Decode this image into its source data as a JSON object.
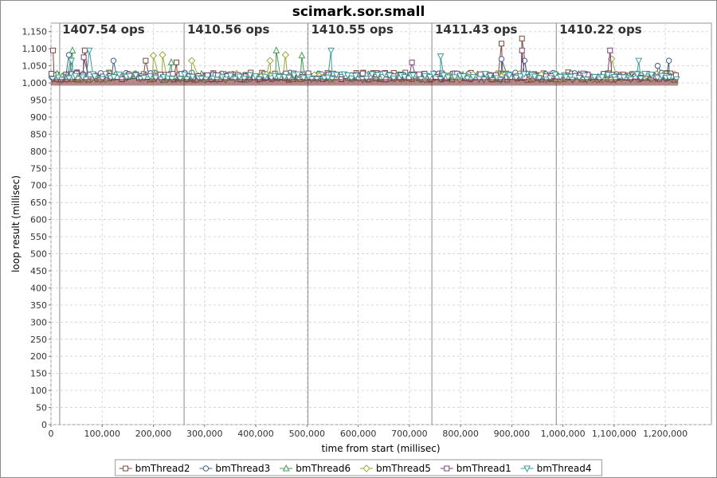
{
  "chart_data": {
    "type": "line",
    "title": "scimark.sor.small",
    "xlabel": "time from start (millisec)",
    "ylabel": "loop result (millisec)",
    "xlim": [
      0,
      1290000
    ],
    "ylim": [
      0,
      1175
    ],
    "x_ticks": [
      "0",
      "100,000",
      "200,000",
      "300,000",
      "400,000",
      "500,000",
      "600,000",
      "700,000",
      "800,000",
      "900,000",
      "1,000,000",
      "1,100,000",
      "1,200,000"
    ],
    "x_tick_values": [
      0,
      100000,
      200000,
      300000,
      400000,
      500000,
      600000,
      700000,
      800000,
      900000,
      1000000,
      1100000,
      1200000
    ],
    "y_ticks": [
      "0",
      "50",
      "100",
      "150",
      "200",
      "250",
      "300",
      "350",
      "400",
      "450",
      "500",
      "550",
      "600",
      "650",
      "700",
      "750",
      "800",
      "850",
      "900",
      "950",
      "1,000",
      "1,050",
      "1,100",
      "1,150"
    ],
    "y_tick_values": [
      0,
      50,
      100,
      150,
      200,
      250,
      300,
      350,
      400,
      450,
      500,
      550,
      600,
      650,
      700,
      750,
      800,
      850,
      900,
      950,
      1000,
      1050,
      1100,
      1150
    ],
    "grid": true,
    "legend_position": "bottom",
    "x_start": 0,
    "x_end": 1225000,
    "phase_markers": [
      17000,
      260000,
      502000,
      744000,
      987000
    ],
    "annotations": [
      {
        "text": "1407.54 ops",
        "x": 22000
      },
      {
        "text": "1410.56 ops",
        "x": 266000
      },
      {
        "text": "1410.55 ops",
        "x": 508000
      },
      {
        "text": "1411.43 ops",
        "x": 750000
      },
      {
        "text": "1410.22 ops",
        "x": 993000
      }
    ],
    "series": [
      {
        "name": "bmThread2",
        "marker": "square",
        "color": "#7a4a3a",
        "base": 1020,
        "spread": 22,
        "spikes": [
          [
            4000,
            1095
          ],
          [
            66000,
            1095
          ],
          [
            185000,
            1065
          ],
          [
            880000,
            1115
          ],
          [
            920000,
            1130
          ],
          [
            245000,
            1060
          ]
        ]
      },
      {
        "name": "bmThread3",
        "marker": "circle",
        "color": "#3e5f8a",
        "base": 1020,
        "spread": 20,
        "spikes": [
          [
            35000,
            1082
          ],
          [
            122000,
            1065
          ],
          [
            880000,
            1070
          ],
          [
            925000,
            1065
          ],
          [
            1207000,
            1065
          ],
          [
            1185000,
            1050
          ]
        ]
      },
      {
        "name": "bmThread6",
        "marker": "triangle-up",
        "color": "#3f9a52",
        "base": 1018,
        "spread": 18,
        "spikes": [
          [
            42000,
            1095
          ],
          [
            440000,
            1095
          ],
          [
            490000,
            1080
          ],
          [
            235000,
            1060
          ]
        ]
      },
      {
        "name": "bmThread5",
        "marker": "diamond",
        "color": "#9aa83a",
        "base": 1018,
        "spread": 18,
        "spikes": [
          [
            200000,
            1080
          ],
          [
            218000,
            1082
          ],
          [
            458000,
            1082
          ],
          [
            275000,
            1065
          ],
          [
            428000,
            1065
          ],
          [
            1095000,
            1070
          ]
        ]
      },
      {
        "name": "bmThread1",
        "marker": "square",
        "color": "#7b3f76",
        "base": 1019,
        "spread": 18,
        "spikes": [
          [
            920000,
            1095
          ],
          [
            1092000,
            1095
          ],
          [
            64000,
            1075
          ],
          [
            705000,
            1060
          ]
        ]
      },
      {
        "name": "bmThread4",
        "marker": "triangle-down",
        "color": "#3c9a9a",
        "base": 1018,
        "spread": 18,
        "spikes": [
          [
            75000,
            1095
          ],
          [
            547000,
            1095
          ],
          [
            761000,
            1078
          ],
          [
            1148000,
            1065
          ],
          [
            40000,
            1065
          ]
        ]
      }
    ]
  }
}
